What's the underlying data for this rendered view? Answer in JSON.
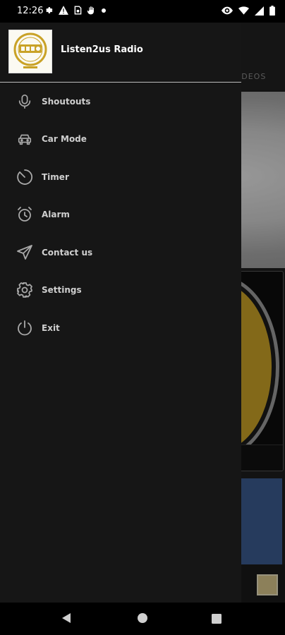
{
  "status_bar": {
    "time": "12:26",
    "left_icons": [
      "gear-icon",
      "warning-icon",
      "sim-card-icon",
      "hand-icon",
      "dot-icon"
    ],
    "right_icons": [
      "eye-icon",
      "wifi-icon",
      "signal-icon",
      "battery-icon"
    ]
  },
  "background": {
    "tab_label": "IDEOS"
  },
  "drawer": {
    "title": "Listen2us Radio",
    "items": [
      {
        "label": "Shoutouts",
        "icon": "microphone-icon"
      },
      {
        "label": "Car Mode",
        "icon": "car-icon"
      },
      {
        "label": "Timer",
        "icon": "timer-icon"
      },
      {
        "label": "Alarm",
        "icon": "alarm-clock-icon"
      },
      {
        "label": "Contact us",
        "icon": "send-icon"
      },
      {
        "label": "Settings",
        "icon": "gear-icon"
      },
      {
        "label": "Exit",
        "icon": "power-icon"
      }
    ]
  },
  "colors": {
    "drawer_bg": "#161616",
    "accent_gold": "#c9a227",
    "icon_gray": "#a9a9a9"
  }
}
